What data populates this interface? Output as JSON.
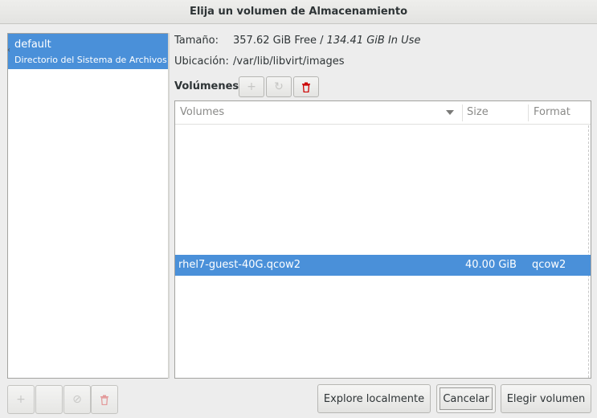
{
  "window": {
    "title": "Elija un volumen de Almacenamiento"
  },
  "pools": [
    {
      "name": "default",
      "type": "Directorio del Sistema de Archivos",
      "selected": true
    }
  ],
  "info": {
    "size_label": "Tamaño:",
    "free_text": "357.62 GiB Free /",
    "inuse_text": "134.41 GiB In Use",
    "location_label": "Ubicación:",
    "location_value": "/var/lib/libvirt/images"
  },
  "volumes": {
    "label": "Volúmenes",
    "columns": [
      "Volumes",
      "Size",
      "Format"
    ],
    "rows": [
      {
        "name": "rhel7-guest-40G.qcow2",
        "size": "40.00 GiB",
        "format": "qcow2",
        "selected": true
      }
    ]
  },
  "buttons": {
    "browse_local": "Explore localmente",
    "cancel": "Cancelar",
    "choose": "Elegir volumen"
  },
  "icons": {
    "add": "add-icon",
    "refresh": "refresh-icon",
    "delete": "delete-icon",
    "stop": "stop-icon",
    "start": "start-icon"
  },
  "colors": {
    "selection": "#4a90d9",
    "delete": "#cc0000"
  }
}
